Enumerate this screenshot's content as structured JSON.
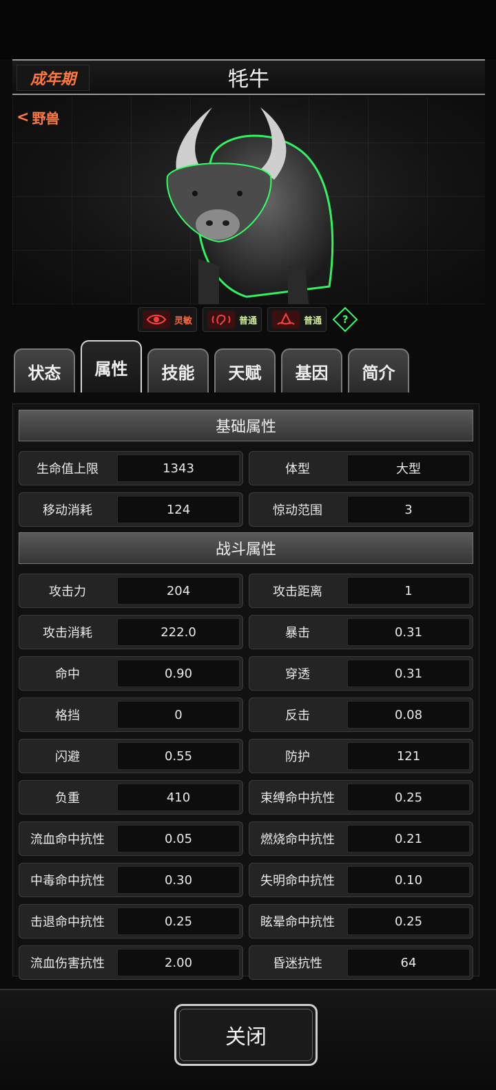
{
  "header": {
    "stage": "成年期",
    "title": "牦牛"
  },
  "creature": {
    "category": "野兽",
    "category_icon": "share-icon"
  },
  "senses": [
    {
      "icon": "eye-icon",
      "label": "灵敏",
      "color": "#ff6a3c"
    },
    {
      "icon": "ear-icon",
      "label": "普通",
      "color": "#cfe8a0"
    },
    {
      "icon": "nose-icon",
      "label": "普通",
      "color": "#cfe8a0"
    }
  ],
  "help": {
    "symbol": "?"
  },
  "tabs": [
    "状态",
    "属性",
    "技能",
    "天赋",
    "基因",
    "简介"
  ],
  "active_tab": "属性",
  "sections": {
    "basic": {
      "title": "基础属性",
      "stats": [
        {
          "label": "生命值上限",
          "value": "1343"
        },
        {
          "label": "体型",
          "value": "大型"
        },
        {
          "label": "移动消耗",
          "value": "124"
        },
        {
          "label": "惊动范围",
          "value": "3"
        }
      ]
    },
    "combat": {
      "title": "战斗属性",
      "stats": [
        {
          "label": "攻击力",
          "value": "204"
        },
        {
          "label": "攻击距离",
          "value": "1"
        },
        {
          "label": "攻击消耗",
          "value": "222.0"
        },
        {
          "label": "暴击",
          "value": "0.31"
        },
        {
          "label": "命中",
          "value": "0.90"
        },
        {
          "label": "穿透",
          "value": "0.31"
        },
        {
          "label": "格挡",
          "value": "0"
        },
        {
          "label": "反击",
          "value": "0.08"
        },
        {
          "label": "闪避",
          "value": "0.55"
        },
        {
          "label": "防护",
          "value": "121"
        },
        {
          "label": "负重",
          "value": "410"
        },
        {
          "label": "束缚命中抗性",
          "value": "0.25"
        },
        {
          "label": "流血命中抗性",
          "value": "0.05"
        },
        {
          "label": "燃烧命中抗性",
          "value": "0.21"
        },
        {
          "label": "中毒命中抗性",
          "value": "0.30"
        },
        {
          "label": "失明命中抗性",
          "value": "0.10"
        },
        {
          "label": "击退命中抗性",
          "value": "0.25"
        },
        {
          "label": "眩晕命中抗性",
          "value": "0.25"
        },
        {
          "label": "流血伤害抗性",
          "value": "2.00"
        },
        {
          "label": "昏迷抗性",
          "value": "64"
        }
      ]
    }
  },
  "footer": {
    "close_label": "关闭"
  },
  "colors": {
    "accent": "#ff7a3c",
    "glow": "#33ff66"
  }
}
